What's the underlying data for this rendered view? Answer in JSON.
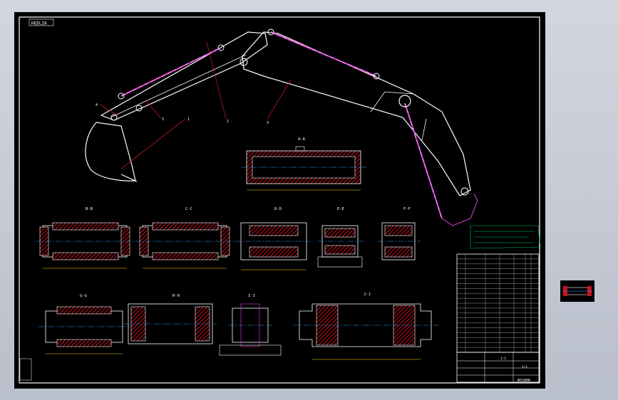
{
  "drawing": {
    "title_tag": "HEDL2A",
    "main_assembly": {
      "leaders": [
        "1",
        "2",
        "3",
        "4",
        "5"
      ]
    },
    "section_labels": {
      "stick_tube": "A-A",
      "joint_a": "B-B",
      "joint_b": "C-C",
      "joint_c": "D-D",
      "joint_d": "E-E",
      "joint_e": "F-F",
      "joint_f": "G-G",
      "joint_g": "H-H",
      "joint_h": "I-I",
      "joint_i": "J-J"
    },
    "title_block": {
      "scale": "1:1",
      "sheet": "1/1",
      "drawing_no": "WY1000"
    }
  },
  "colors": {
    "background": "#000000",
    "frame": "#ffffff",
    "section_hatch": "#c8141e",
    "centerline": "#2aa0ff",
    "cylinder": "#e040e0",
    "dimension": "#00c060",
    "annotation": "#ffd700",
    "viewport": "#c7ccd6"
  }
}
